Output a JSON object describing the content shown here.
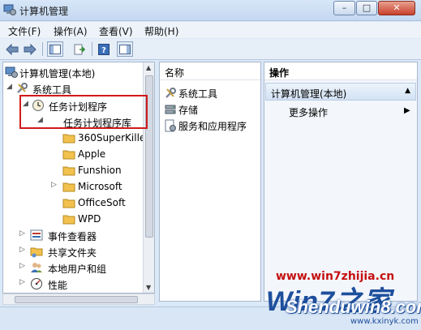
{
  "window": {
    "title": "计算机管理",
    "controls": {
      "minimize": "–",
      "maximize": "□",
      "close": "✕"
    }
  },
  "menubar": [
    "文件(F)",
    "操作(A)",
    "查看(V)",
    "帮助(H)"
  ],
  "toolbar": {
    "items": [
      "back-icon",
      "forward-icon",
      "show-hide-tree-icon",
      "export-list-icon",
      "help-icon",
      "show-hide-action-pane-icon"
    ]
  },
  "tree": [
    {
      "label": "计算机管理(本地)",
      "icon": "computer-management-icon",
      "expander": ""
    },
    {
      "label": "系统工具",
      "icon": "system-tools-icon",
      "expander": "◢"
    },
    {
      "label": "任务计划程序",
      "icon": "clock-icon",
      "expander": "◢"
    },
    {
      "label": "任务计划程序库",
      "icon": "",
      "expander": "◢"
    },
    {
      "label": "360SuperKille",
      "icon": "folder-icon",
      "expander": ""
    },
    {
      "label": "Apple",
      "icon": "folder-icon",
      "expander": ""
    },
    {
      "label": "Funshion",
      "icon": "folder-icon",
      "expander": ""
    },
    {
      "label": "Microsoft",
      "icon": "folder-icon",
      "expander": "▷"
    },
    {
      "label": "OfficeSoft",
      "icon": "folder-icon",
      "expander": ""
    },
    {
      "label": "WPD",
      "icon": "folder-icon",
      "expander": ""
    },
    {
      "label": "事件查看器",
      "icon": "event-viewer-icon",
      "expander": "▷"
    },
    {
      "label": "共享文件夹",
      "icon": "shared-folders-icon",
      "expander": "▷"
    },
    {
      "label": "本地用户和组",
      "icon": "users-groups-icon",
      "expander": "▷"
    },
    {
      "label": "性能",
      "icon": "performance-icon",
      "expander": "▷"
    }
  ],
  "middle": {
    "column_header": "名称",
    "items": [
      {
        "label": "系统工具",
        "icon": "system-tools-icon"
      },
      {
        "label": "存储",
        "icon": "storage-icon"
      },
      {
        "label": "服务和应用程序",
        "icon": "services-apps-icon"
      }
    ]
  },
  "actions": {
    "header": "操作",
    "group_title": "计算机管理(本地)",
    "group_arrow": "▲",
    "more": "更多操作",
    "more_arrow": "▶"
  },
  "watermark": {
    "url": "www.win7zhijia.cn",
    "logo": "Win7之家",
    "brand": "Shenduwin8.com",
    "site": "www.kxinyk.com"
  },
  "colors": {
    "highlight_box": "#d11a1a",
    "folder": "#f2c14e",
    "accent": "#1e4f9c"
  }
}
